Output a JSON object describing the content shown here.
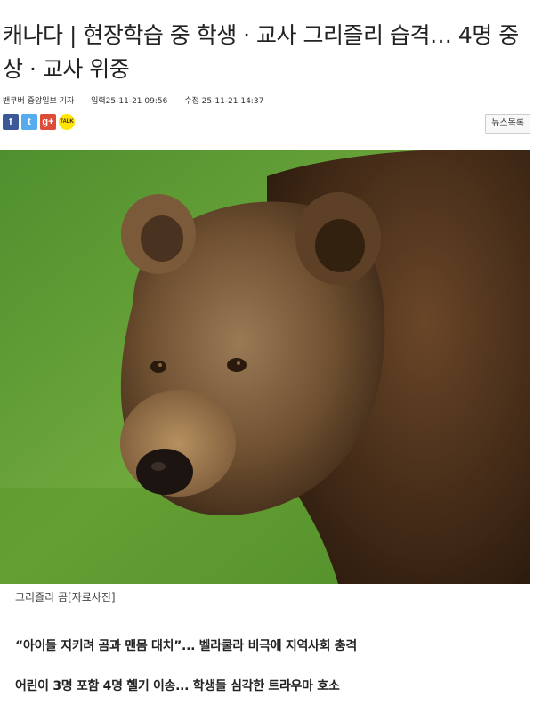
{
  "article": {
    "headline": "캐나다 | 현장학습 중 학생 · 교사 그리즐리 습격… 4명 중상 · 교사 위중",
    "reporter": "밴쿠버 중앙일보 기자",
    "published": "입력25-11-21 09:56",
    "modified": "수정 25-11-21 14:37",
    "news_list_label": "뉴스목록",
    "photo_caption": "그리즐리 곰[자료사진]",
    "subheads": [
      "“아이들 지키려 곰과 맨몸 대치”... 벨라쿨라 비극에 지역사회 충격",
      "어린이 3명 포함 4명 헬기 이송... 학생들 심각한 트라우마 호소"
    ]
  },
  "share": {
    "facebook": "f",
    "twitter": "t",
    "googleplus": "g+",
    "kakaotalk": "TALK"
  }
}
